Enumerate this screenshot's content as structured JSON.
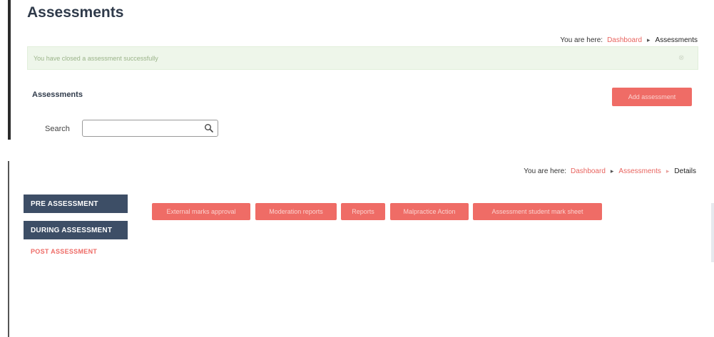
{
  "page": {
    "title": "Assessments"
  },
  "breadcrumb_top": {
    "label": "You are here:",
    "items": [
      "Dashboard",
      "Assessments"
    ]
  },
  "alert": {
    "message": "You have closed a assessment successfully",
    "close": "⊗"
  },
  "section": {
    "title": "Assessments",
    "add_button": "Add assessment"
  },
  "search": {
    "label": "Search",
    "value": "",
    "placeholder": ""
  },
  "breadcrumb_bottom": {
    "label": "You are here:",
    "items": [
      "Dashboard",
      "Assessments",
      "Details"
    ]
  },
  "side_tabs": {
    "pre": "PRE ASSESSMENT",
    "during": "DURING ASSESSMENT",
    "post": "POST ASSESSMENT"
  },
  "actions": [
    "External marks approval",
    "Moderation reports",
    "Reports",
    "Malpractice Action",
    "Assessment student mark sheet"
  ],
  "colors": {
    "accent": "#ef6c66",
    "nav": "#3d4e66",
    "alert_bg": "#eef6ea"
  }
}
